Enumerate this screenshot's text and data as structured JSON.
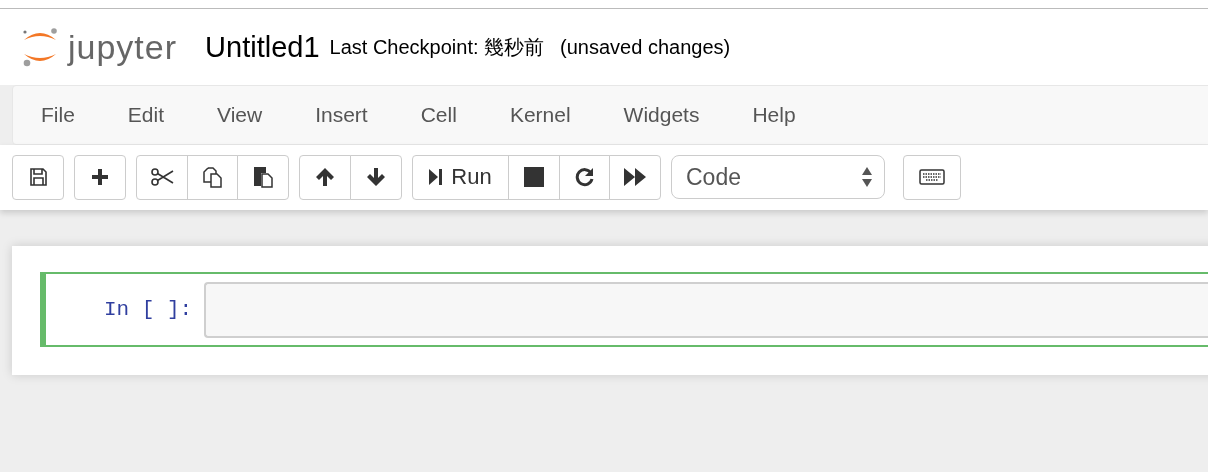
{
  "header": {
    "logo_text": "jupyter",
    "notebook_name": "Untitled1",
    "checkpoint": "Last Checkpoint: 幾秒前",
    "save_status": "(unsaved changes)"
  },
  "menu": [
    "File",
    "Edit",
    "View",
    "Insert",
    "Cell",
    "Kernel",
    "Widgets",
    "Help"
  ],
  "toolbar": [
    {
      "buttons": [
        {
          "kind": "save"
        }
      ]
    },
    {
      "buttons": [
        {
          "kind": "add"
        }
      ]
    },
    {
      "buttons": [
        {
          "kind": "cut"
        },
        {
          "kind": "copy"
        },
        {
          "kind": "paste"
        }
      ]
    },
    {
      "buttons": [
        {
          "kind": "up"
        },
        {
          "kind": "down"
        }
      ]
    },
    {
      "buttons": [
        {
          "kind": "run",
          "label": "Run"
        },
        {
          "kind": "stop"
        },
        {
          "kind": "restart"
        },
        {
          "kind": "fast-forward"
        }
      ]
    }
  ],
  "cell_type": {
    "value": "Code"
  },
  "cells": [
    {
      "prompt": "In [ ]:",
      "selected": true
    }
  ]
}
